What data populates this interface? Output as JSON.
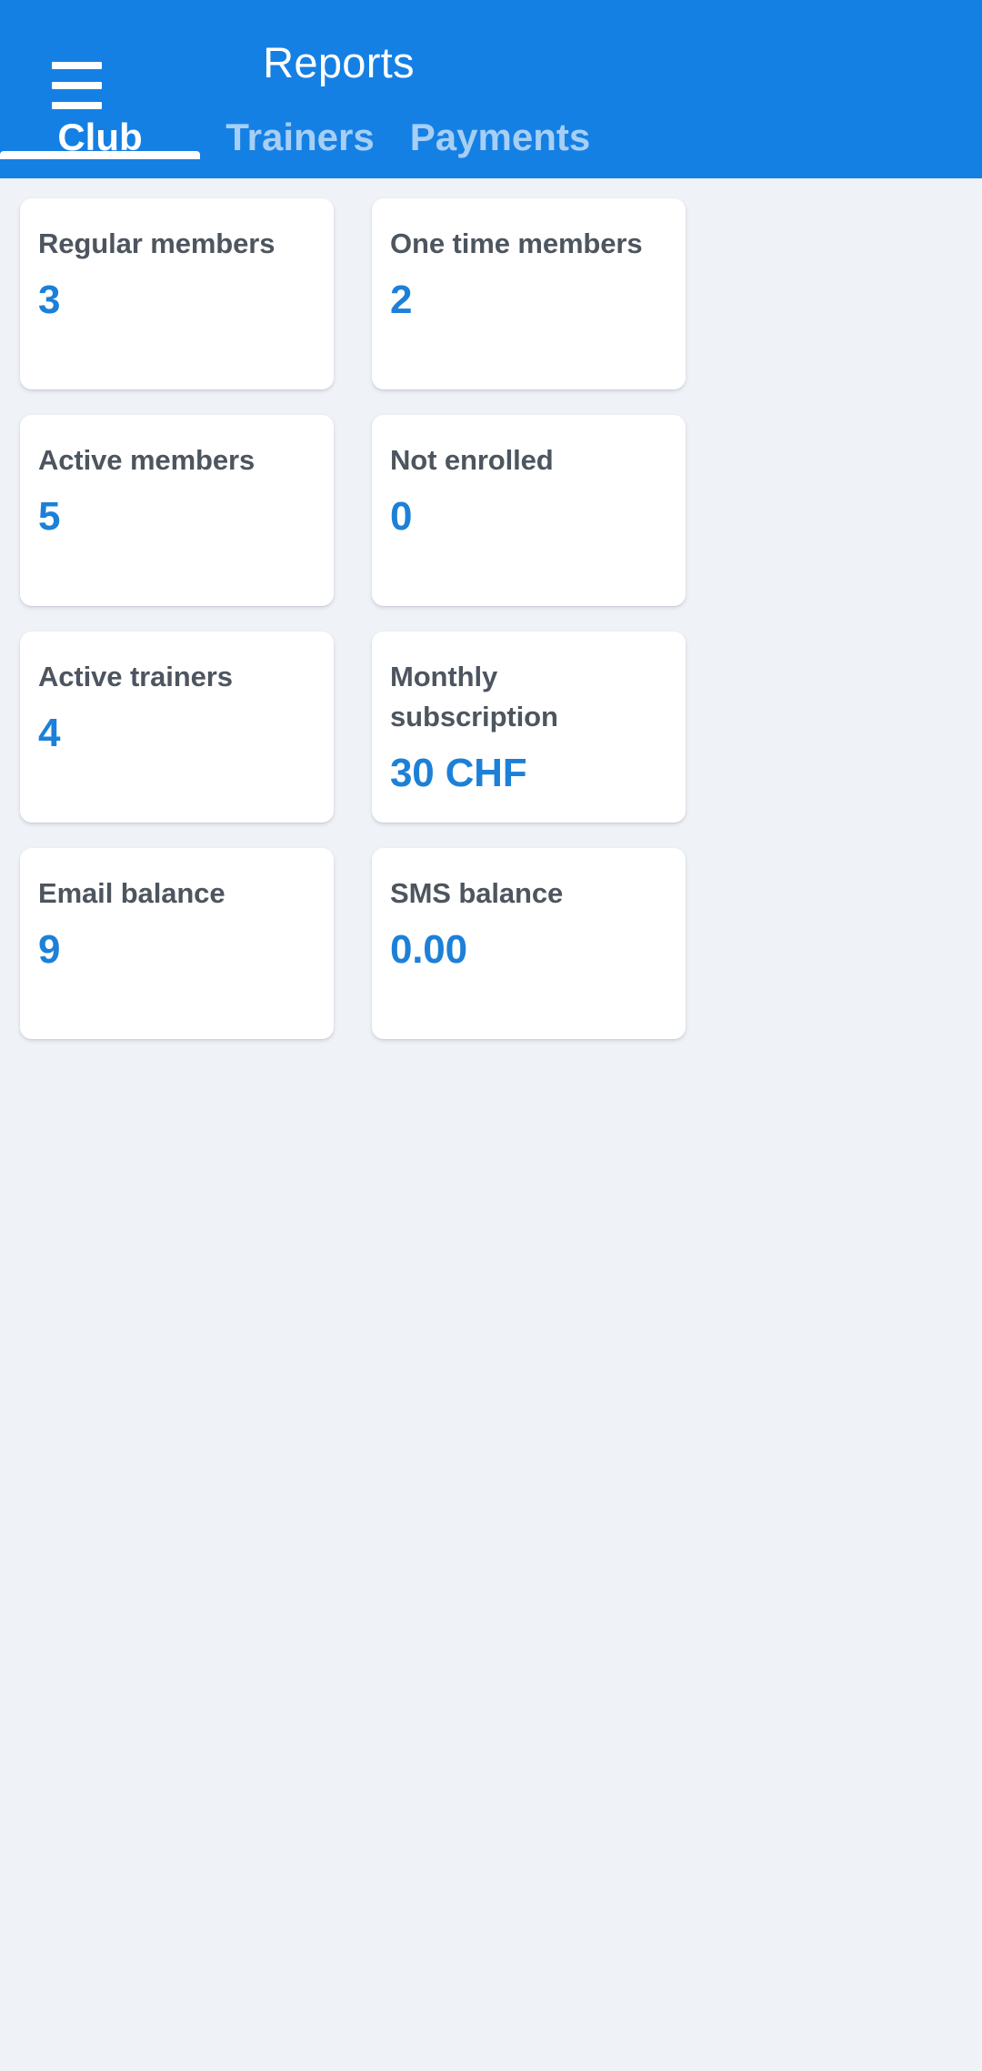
{
  "appbar": {
    "title": "Reports",
    "menu_icon": "hamburger-menu-icon",
    "background_color": "#1580e4"
  },
  "tabs": [
    {
      "label": "Club",
      "active": true
    },
    {
      "label": "Trainers",
      "active": false
    },
    {
      "label": "Payments",
      "active": false
    }
  ],
  "theme": {
    "accent": "#1580e4",
    "value_color": "#1d80d8",
    "label_color": "#4d555f",
    "page_background": "#eff2f7",
    "card_background": "#ffffff"
  },
  "cards": [
    {
      "label": "Regular members",
      "value": "3"
    },
    {
      "label": "One time members",
      "value": "2"
    },
    {
      "label": "Active members",
      "value": "5"
    },
    {
      "label": "Not enrolled",
      "value": "0"
    },
    {
      "label": "Active trainers",
      "value": "4"
    },
    {
      "label": "Monthly subscription",
      "value": "30 CHF"
    },
    {
      "label": "Email balance",
      "value": "9"
    },
    {
      "label": "SMS balance",
      "value": "0.00"
    }
  ]
}
